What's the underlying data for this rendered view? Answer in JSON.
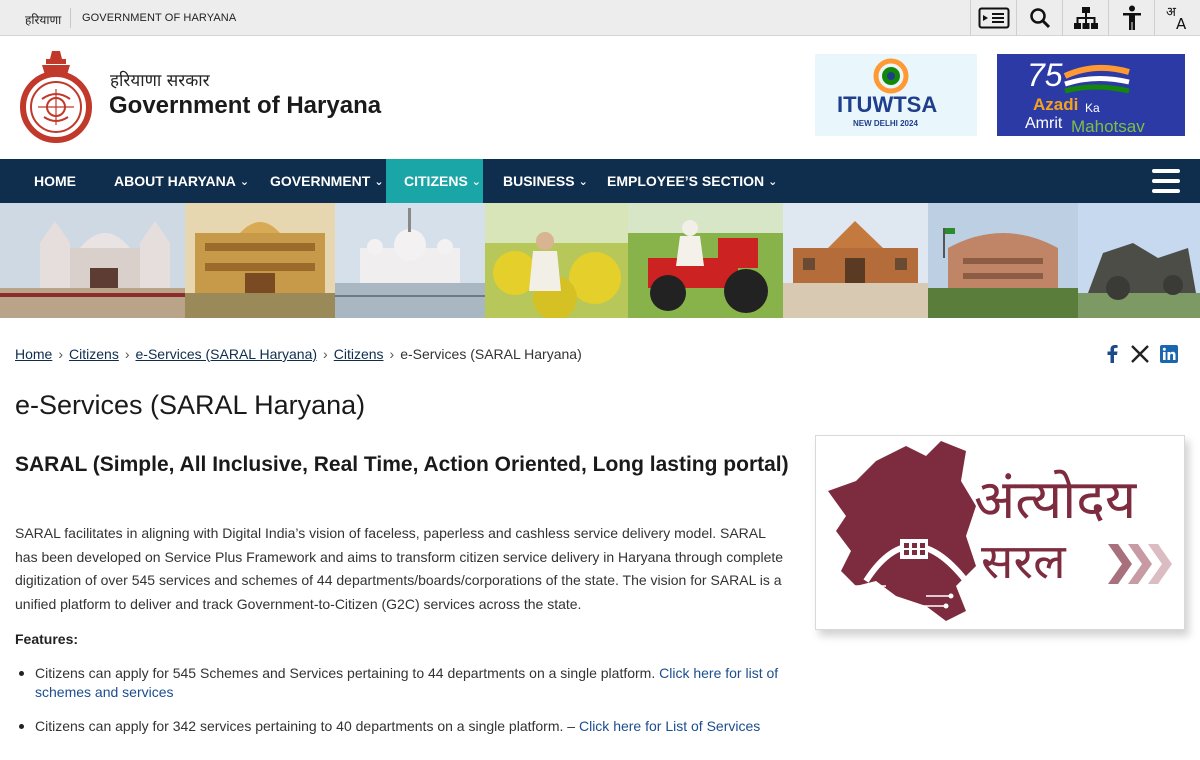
{
  "topbar": {
    "language_link": "हरियाणा",
    "government_label": "GOVERNMENT OF HARYANA",
    "tools": [
      {
        "icon": "skip-to-content-icon"
      },
      {
        "icon": "search-icon"
      },
      {
        "icon": "sitemap-icon"
      },
      {
        "icon": "accessibility-icon"
      },
      {
        "icon": "language-icon"
      }
    ]
  },
  "header": {
    "hindi_title": "हरियाणा सरकार",
    "title": "Government of Haryana",
    "emblem_text": "GOVT. OF HARYANA",
    "itu_banner": {
      "brand": "ITUWTSA",
      "location": "NEW DELHI 2024"
    },
    "azadi_banner": {
      "number": "75",
      "line1": "Azadi",
      "line_ka": "Ka",
      "line2": "Amrit",
      "line3": "Mahotsav"
    }
  },
  "nav": {
    "items": [
      {
        "label": "HOME",
        "has_dropdown": false
      },
      {
        "label": "ABOUT HARYANA",
        "has_dropdown": true
      },
      {
        "label": "GOVERNMENT",
        "has_dropdown": true
      },
      {
        "label": "CITIZENS",
        "has_dropdown": true,
        "active": true
      },
      {
        "label": "BUSINESS",
        "has_dropdown": true
      },
      {
        "label": "EMPLOYEE’S SECTION",
        "has_dropdown": true
      }
    ],
    "menu_icon": "hamburger-icon"
  },
  "breadcrumb": {
    "items": [
      "Home",
      "Citizens",
      "e-Services (SARAL Haryana)",
      "Citizens"
    ],
    "current": "e-Services (SARAL Haryana)",
    "separator": "›"
  },
  "share": {
    "icons": [
      "facebook-icon",
      "x-icon",
      "linkedin-icon"
    ]
  },
  "main": {
    "page_title": "e-Services (SARAL Haryana)",
    "section_title": "SARAL (Simple, All Inclusive, Real Time, Action Oriented, Long lasting portal)",
    "paragraph": "SARAL facilitates in aligning with Digital India’s vision of faceless, paperless and cashless service delivery model. SARAL has been developed on Service Plus Framework and aims to transform citizen service delivery in Haryana through complete digitization of over 545 services and schemes of 44 departments/boards/corporations of the state. The vision for SARAL is a unified platform to deliver and track Government-to-Citizen (G2C) services across the state.",
    "features_heading": "Features:",
    "features": [
      {
        "text": "Citizens can apply for 545 Schemes and Services pertaining to 44 departments on a single platform. ",
        "link": "Click here for list of schemes and services"
      },
      {
        "text": "Citizens can apply for 342 services pertaining to 40 departments on a single platform. – ",
        "link": "Click here for List of Services"
      }
    ]
  },
  "saral_logo": {
    "word1": "अंत्योदय",
    "word2": "सरल"
  },
  "colors": {
    "nav_bg": "#0f2d4c",
    "nav_active": "#1aa6a6",
    "topbar_bg": "#ededed",
    "saral_maroon": "#7d2b3e",
    "link": "#1b4d8f"
  }
}
